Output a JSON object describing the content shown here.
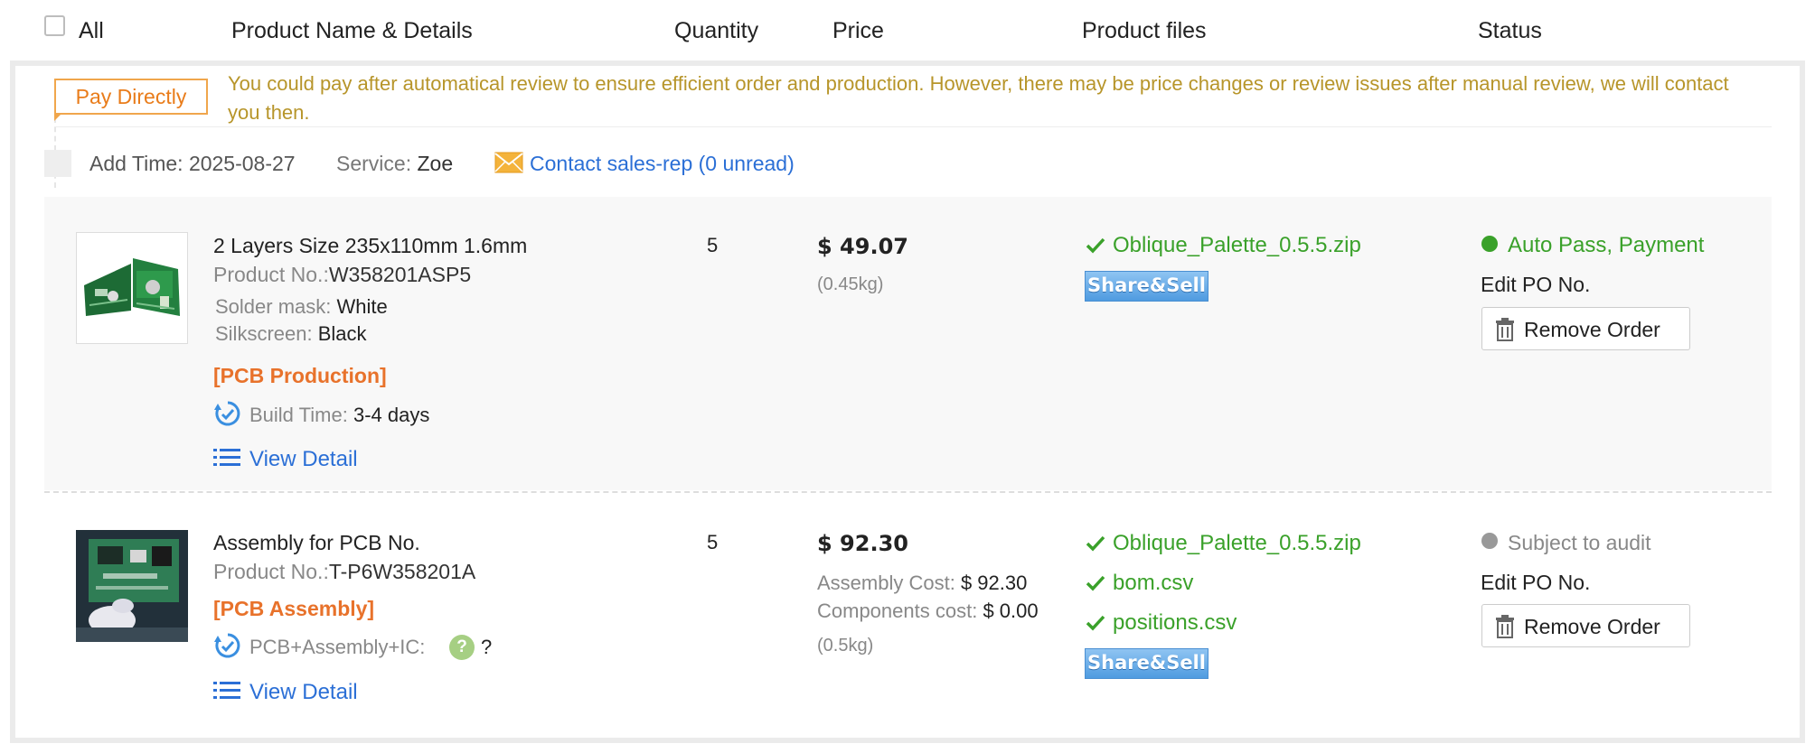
{
  "header": {
    "all_label": "All",
    "product_label": "Product Name & Details",
    "quantity_label": "Quantity",
    "price_label": "Price",
    "files_label": "Product files",
    "status_label": "Status"
  },
  "order": {
    "pay_tag": "Pay Directly",
    "notice": "You could pay after automatical review to ensure efficient order and production. However, there may be price changes or review issues after manual review, we will contact you then.",
    "add_time_label": "Add Time:",
    "add_time": "2025-08-27",
    "service_label": "Service:",
    "service": "Zoe",
    "contact_label": "Contact sales-rep (0 unread)"
  },
  "items": [
    {
      "title": "2 Layers Size 235x110mm 1.6mm",
      "product_no_label": "Product No.:",
      "product_no": "W358201ASP5",
      "solder_label": "Solder mask:",
      "solder": "White",
      "silk_label": "Silkscreen:",
      "silk": "Black",
      "category": "[PCB Production]",
      "build_label": "Build Time:",
      "build": "3-4 days",
      "view_detail": "View Detail",
      "quantity": "5",
      "price": "$ 49.07",
      "weight": "(0.45kg)",
      "files": [
        "Oblique_Palette_0.5.5.zip"
      ],
      "share_label": "Share&Sell",
      "status": "Auto Pass, Payment",
      "status_color": "#3aa12a",
      "edit_po": "Edit PO No.",
      "remove": "Remove Order"
    },
    {
      "title": "Assembly for PCB No.",
      "product_no_label": "Product No.:",
      "product_no": "T-P6W358201A",
      "category": "[PCB Assembly]",
      "build_label": "PCB+Assembly+IC:",
      "help_mark": "?",
      "build": "?",
      "view_detail": "View Detail",
      "quantity": "5",
      "price": "$ 92.30",
      "assembly_cost_label": "Assembly Cost:",
      "assembly_cost": "$ 92.30",
      "components_cost_label": "Components cost:",
      "components_cost": "$ 0.00",
      "weight": "(0.5kg)",
      "files": [
        "Oblique_Palette_0.5.5.zip",
        "bom.csv",
        "positions.csv"
      ],
      "share_label": "Share&Sell",
      "status": "Subject to audit",
      "status_color": "#999999",
      "edit_po": "Edit PO No.",
      "remove": "Remove Order"
    }
  ]
}
